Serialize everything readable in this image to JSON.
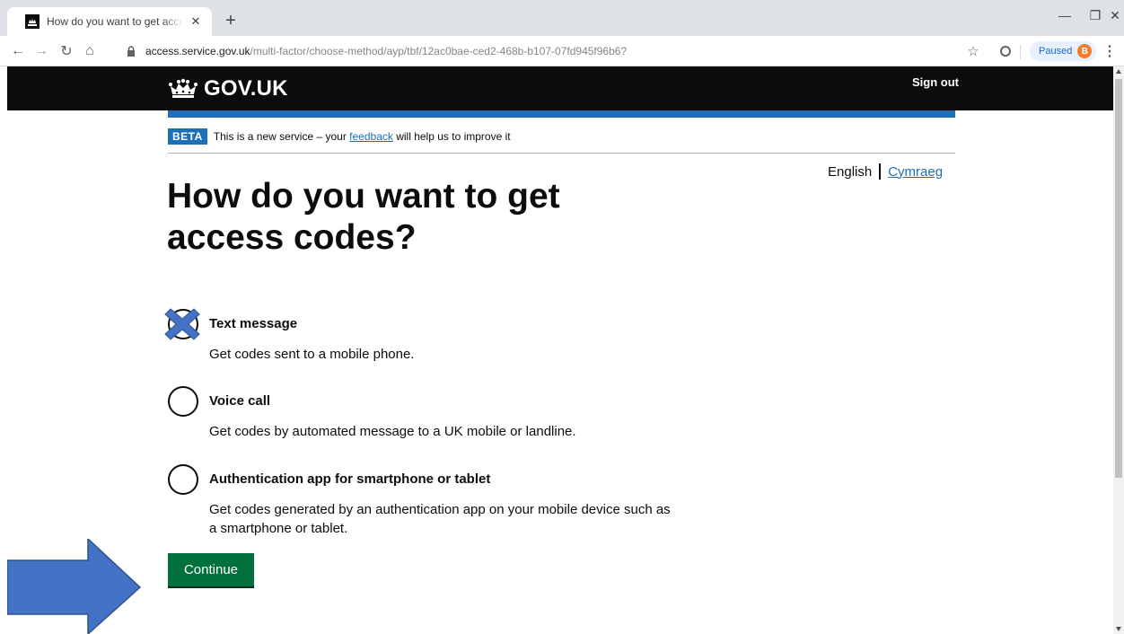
{
  "browser": {
    "tab_title": "How do you want to get access codes?",
    "new_tab": "+",
    "url_host": "access.service.gov.uk",
    "url_path": "/multi-factor/choose-method/ayp/tbf/12ac0bae-ced2-468b-b107-07fd945f96b6?",
    "profile_status": "Paused",
    "profile_initial": "B"
  },
  "header": {
    "logo_text": "GOV.UK",
    "sign_out": "Sign out"
  },
  "beta": {
    "tag": "BETA",
    "text_before": "This is a new service – your ",
    "link": "feedback",
    "text_after": " will help us to improve it"
  },
  "language": {
    "current": "English",
    "other": "Cymraeg"
  },
  "page": {
    "title": "How do you want to get access codes?"
  },
  "options": [
    {
      "label": "Text message",
      "hint": "Get codes sent to a mobile phone."
    },
    {
      "label": "Voice call",
      "hint": "Get codes by automated message to a UK mobile or landline."
    },
    {
      "label": "Authentication app for smartphone or tablet",
      "hint": "Get codes generated by an authentication app on your mobile device such as a smartphone or tablet."
    }
  ],
  "form": {
    "continue": "Continue"
  },
  "colors": {
    "govuk_black": "#0b0c0c",
    "govuk_blue": "#1d70b8",
    "govuk_green": "#00703c",
    "annotation_blue": "#4472c4"
  },
  "icons": [
    "crown-icon",
    "lock-icon",
    "star-icon",
    "back-icon",
    "forward-icon",
    "reload-icon",
    "home-icon"
  ]
}
